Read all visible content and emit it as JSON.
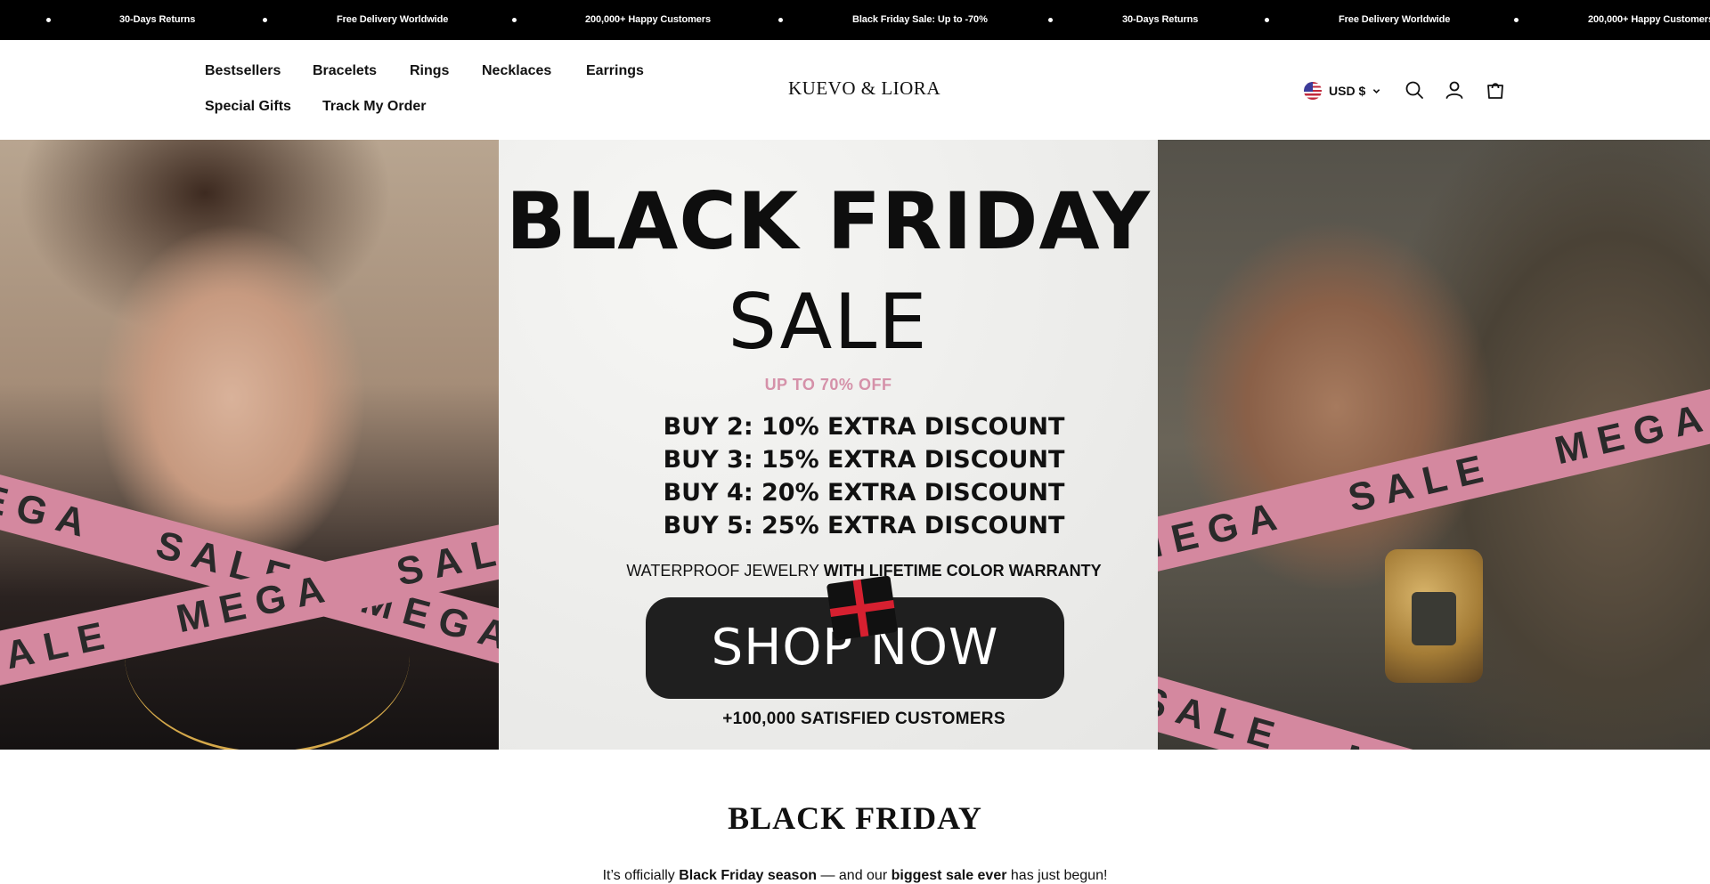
{
  "announcement_bar": {
    "items": [
      "30-Days Returns",
      "Free Delivery Worldwide",
      "200,000+ Happy Customers",
      "Black Friday Sale: Up to -70%",
      "30-Days Returns",
      "Free Delivery Worldwide",
      "200,000+ Happy Customers"
    ]
  },
  "header": {
    "nav": [
      "Bestsellers",
      "Bracelets",
      "Rings",
      "Necklaces",
      "Earrings",
      "Special Gifts",
      "Track My Order"
    ],
    "logo": "KUEVO & LIORA",
    "currency": "USD $",
    "icons": [
      "search-icon",
      "account-icon",
      "cart-icon"
    ]
  },
  "hero": {
    "title": "BLACK FRIDAY",
    "subtitle": "SALE",
    "tagline": "UP TO 70% OFF",
    "deals": [
      "BUY 2: 10% EXTRA DISCOUNT",
      "BUY 3: 15% EXTRA DISCOUNT",
      "BUY 4: 20% EXTRA DISCOUNT",
      "BUY 5: 25% EXTRA DISCOUNT"
    ],
    "warranty_plain": "WATERPROOF JEWELRY ",
    "warranty_bold": "WITH LIFETIME COLOR  WARRANTY",
    "cta": "SHOP NOW",
    "customers": "+100,000 SATISFIED CUSTOMERS",
    "ribbon_words": [
      "MEGA",
      "SALE"
    ],
    "accent_pink": "#d4889f"
  },
  "section": {
    "title": "BLACK FRIDAY",
    "text_1": "It’s officially ",
    "text_2": "Black Friday season",
    "text_3": " — and our ",
    "text_4": "biggest sale ever",
    "text_5": " has just begun!"
  }
}
